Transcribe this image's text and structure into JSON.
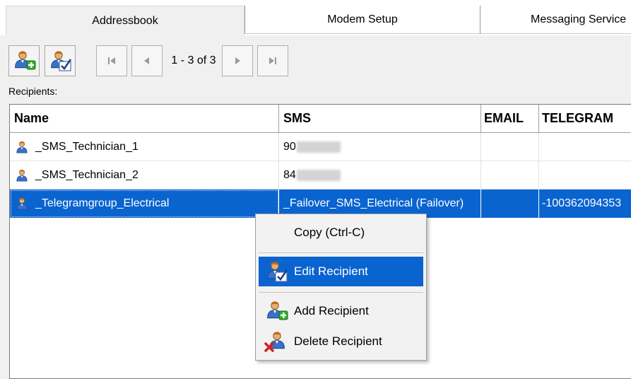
{
  "tabs": [
    {
      "label": "Addressbook",
      "active": true
    },
    {
      "label": "Modem Setup",
      "active": false
    },
    {
      "label": "Messaging Service",
      "active": false
    }
  ],
  "toolbar": {
    "add_icon": "add-recipient-icon",
    "edit_icon": "edit-recipient-icon",
    "page_label": "1 - 3 of 3"
  },
  "recipients_label": "Recipients:",
  "grid": {
    "columns": [
      "Name",
      "SMS",
      "EMAIL",
      "TELEGRAM"
    ],
    "rows": [
      {
        "name": "_SMS_Technician_1",
        "sms": "90",
        "email": "",
        "telegram": "",
        "selected": false
      },
      {
        "name": "_SMS_Technician_2",
        "sms": "84",
        "email": "",
        "telegram": "",
        "selected": false
      },
      {
        "name": "_Telegramgroup_Electrical",
        "sms": "_Failover_SMS_Electrical (Failover)",
        "email": "",
        "telegram": "-100362094353",
        "selected": true
      }
    ]
  },
  "context_menu": {
    "copy": "Copy (Ctrl-C)",
    "edit": "Edit Recipient",
    "add": "Add Recipient",
    "delete": "Delete Recipient"
  },
  "colors": {
    "selection": "#0a64d0",
    "window_bg": "#f0f0f0"
  }
}
